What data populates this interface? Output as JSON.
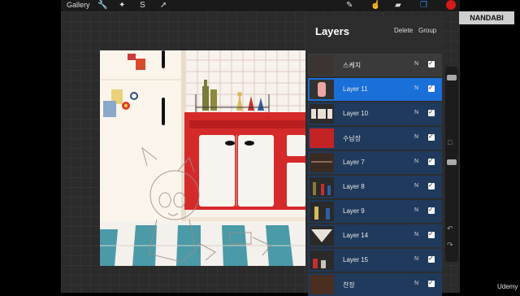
{
  "topbar": {
    "gallery_label": "Gallery"
  },
  "watermark": {
    "brand": "NANDABI",
    "platform": "Udemy"
  },
  "layers_panel": {
    "title": "Layers",
    "delete_label": "Delete",
    "group_label": "Group",
    "layers": [
      {
        "name": "스케치",
        "blend": "N",
        "visible": true,
        "state": "normal"
      },
      {
        "name": "Layer 11",
        "blend": "N",
        "visible": true,
        "state": "active"
      },
      {
        "name": "Layer 10",
        "blend": "N",
        "visible": true,
        "state": "selected"
      },
      {
        "name": "수납장",
        "blend": "N",
        "visible": true,
        "state": "selected"
      },
      {
        "name": "Layer 7",
        "blend": "N",
        "visible": true,
        "state": "selected"
      },
      {
        "name": "Layer 8",
        "blend": "N",
        "visible": true,
        "state": "selected"
      },
      {
        "name": "Layer 9",
        "blend": "N",
        "visible": true,
        "state": "selected"
      },
      {
        "name": "Layer 14",
        "blend": "N",
        "visible": true,
        "state": "selected"
      },
      {
        "name": "Layer 15",
        "blend": "N",
        "visible": true,
        "state": "selected"
      },
      {
        "name": "찬장",
        "blend": "N",
        "visible": true,
        "state": "selected"
      }
    ]
  },
  "colors": {
    "accent": "#1a6fd8",
    "selected_row": "#1f3a5c",
    "current_color": "#d21b1b"
  }
}
